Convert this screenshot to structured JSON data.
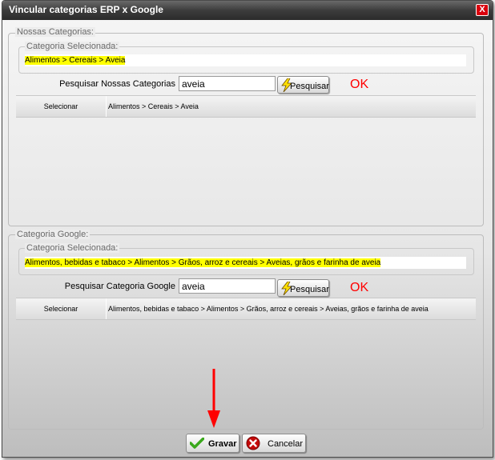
{
  "dialog": {
    "title": "Vincular categorias ERP x Google",
    "close_label": "X"
  },
  "ours": {
    "legend": "Nossas Categorias:",
    "selected_legend": "Categoria Selecionada:",
    "selected_value": "Alimentos > Cereais > Aveia",
    "search_label": "Pesquisar Nossas Categorias",
    "search_value": "aveia",
    "search_button": "Pesquisar",
    "status": "OK",
    "results": [
      {
        "action": "Selecionar",
        "path": "Alimentos > Cereais > Aveia"
      }
    ]
  },
  "google": {
    "legend": "Categoria Google:",
    "selected_legend": "Categoria Selecionada:",
    "selected_value": "Alimentos, bebidas e tabaco > Alimentos > Grãos, arroz e cereais > Aveias, grãos e farinha de aveia",
    "search_label": "Pesquisar Categoria Google",
    "search_value": "aveia",
    "search_button": "Pesquisar",
    "status": "OK",
    "results": [
      {
        "action": "Selecionar",
        "path": "Alimentos, bebidas e tabaco > Alimentos > Grãos, arroz e cereais > Aveias, grãos e farinha de aveia"
      }
    ]
  },
  "footer": {
    "save_label": "Gravar",
    "cancel_label": "Cancelar"
  },
  "colors": {
    "highlight": "#ffff00",
    "ok": "#ff0000",
    "arrow": "#ff0000"
  }
}
